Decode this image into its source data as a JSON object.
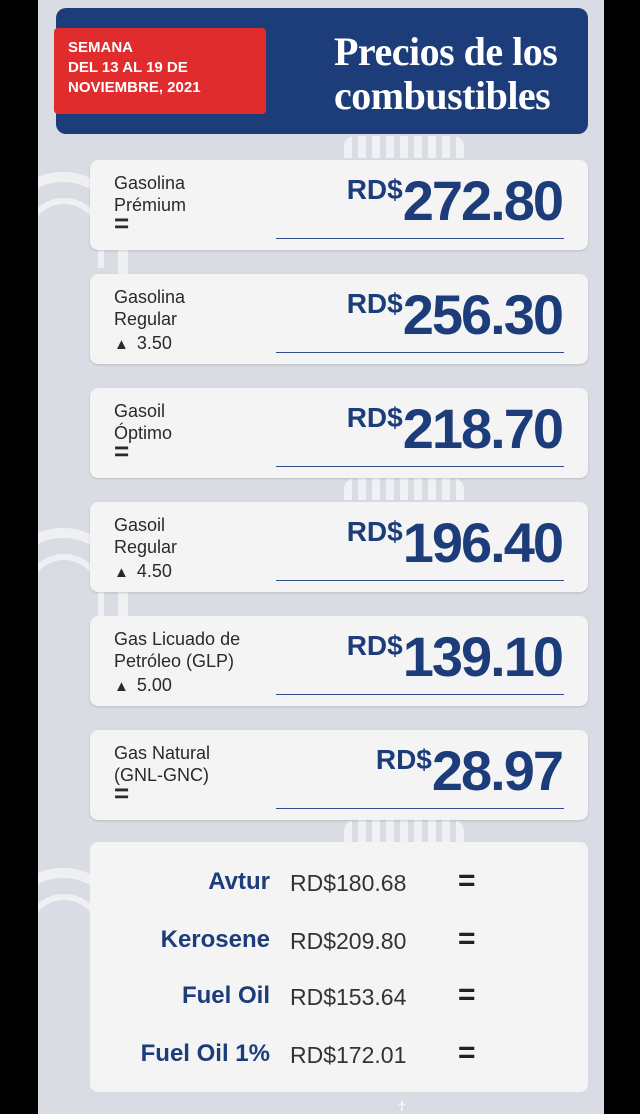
{
  "header": {
    "week": [
      "SEMANA",
      "DEL 13 AL 19 DE",
      "NOVIEMBRE, 2021"
    ],
    "title": [
      "Precios de los",
      "combustibles"
    ]
  },
  "fuels": [
    {
      "name": [
        "Gasolina",
        "Prémium"
      ],
      "change": "=",
      "currency": "RD$",
      "price": "272.80"
    },
    {
      "name": [
        "Gasolina",
        "Regular"
      ],
      "change": "3.50",
      "change_icon": "up-triangle",
      "currency": "RD$",
      "price": "256.30"
    },
    {
      "name": [
        "Gasoil",
        "Óptimo"
      ],
      "change": "=",
      "currency": "RD$",
      "price": "218.70"
    },
    {
      "name": [
        "Gasoil",
        "Regular"
      ],
      "change": "4.50",
      "change_icon": "up-triangle",
      "currency": "RD$",
      "price": "196.40"
    },
    {
      "name": [
        "Gas Licuado de",
        "Petróleo (GLP)"
      ],
      "change": "5.00",
      "change_icon": "up-triangle",
      "currency": "RD$",
      "price": "139.10"
    },
    {
      "name": [
        "Gas Natural",
        "(GNL-GNC)"
      ],
      "change": "=",
      "currency": "RD$",
      "price": "28.97"
    }
  ],
  "other_fuels": [
    {
      "name": "Avtur",
      "price": "RD$180.68",
      "change": "="
    },
    {
      "name": "Kerosene",
      "price": "RD$209.80",
      "change": "="
    },
    {
      "name": "Fuel Oil",
      "price": "RD$153.64",
      "change": "="
    },
    {
      "name": "Fuel Oil 1%",
      "price": "RD$172.01",
      "change": "="
    }
  ],
  "colors": {
    "navy": "#1c3c7a",
    "red": "#e02c2c",
    "card": "#f4f4f4",
    "background": "#d9dde3"
  }
}
